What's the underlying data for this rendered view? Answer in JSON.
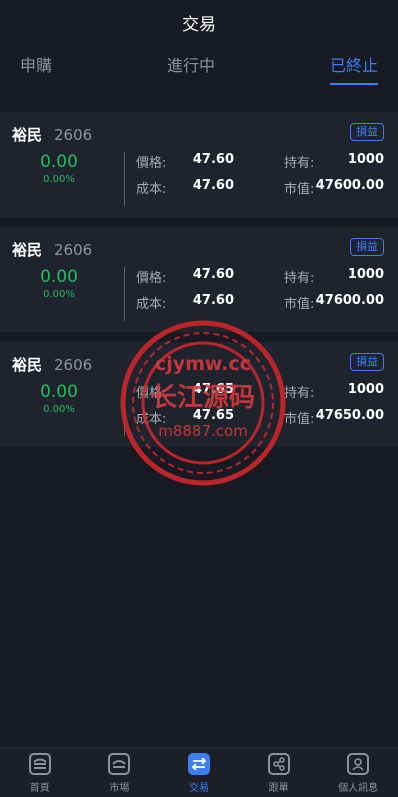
{
  "header": {
    "title": "交易"
  },
  "tabs": [
    {
      "label": "申購",
      "active": false
    },
    {
      "label": "進行中",
      "active": false
    },
    {
      "label": "已終止",
      "active": true
    }
  ],
  "labels": {
    "price": "價格:",
    "cost": "成本:",
    "hold": "持有:",
    "market_value": "市值:",
    "pl_button": "損益"
  },
  "positions": [
    {
      "name": "裕民",
      "code": "2606",
      "change": "0.00",
      "change_pct": "0.00%",
      "price": "47.60",
      "cost": "47.60",
      "hold": "1000",
      "market_value": "47600.00"
    },
    {
      "name": "裕民",
      "code": "2606",
      "change": "0.00",
      "change_pct": "0.00%",
      "price": "47.60",
      "cost": "47.60",
      "hold": "1000",
      "market_value": "47600.00"
    },
    {
      "name": "裕民",
      "code": "2606",
      "change": "0.00",
      "change_pct": "0.00%",
      "price": "47.65",
      "cost": "47.65",
      "hold": "1000",
      "market_value": "47650.00"
    }
  ],
  "watermark": {
    "line1": "cjymw.cc",
    "line2": "长江源码",
    "line3": "m8887.com"
  },
  "bottom_nav": [
    {
      "label": "首頁",
      "icon": "home-icon"
    },
    {
      "label": "市場",
      "icon": "market-icon"
    },
    {
      "label": "交易",
      "icon": "trade-icon",
      "active": true
    },
    {
      "label": "跟單",
      "icon": "share-icon"
    },
    {
      "label": "個人訊息",
      "icon": "profile-icon"
    }
  ],
  "colors": {
    "accent": "#3b7ff3",
    "up": "#1fbf5b",
    "background": "#171a22",
    "card": "#1f232e"
  }
}
